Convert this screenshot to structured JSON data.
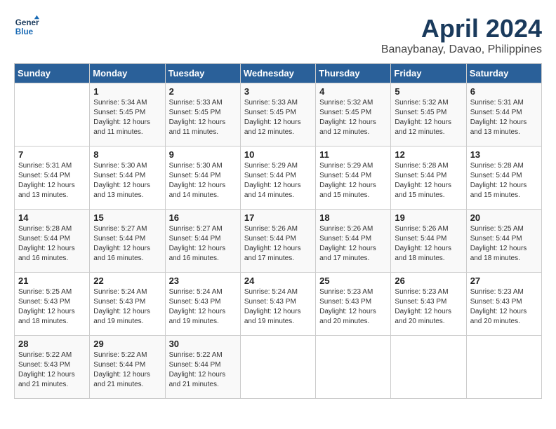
{
  "header": {
    "logo_line1": "General",
    "logo_line2": "Blue",
    "month_title": "April 2024",
    "subtitle": "Banaybanay, Davao, Philippines"
  },
  "weekdays": [
    "Sunday",
    "Monday",
    "Tuesday",
    "Wednesday",
    "Thursday",
    "Friday",
    "Saturday"
  ],
  "weeks": [
    [
      {
        "day": "",
        "info": ""
      },
      {
        "day": "1",
        "info": "Sunrise: 5:34 AM\nSunset: 5:45 PM\nDaylight: 12 hours\nand 11 minutes."
      },
      {
        "day": "2",
        "info": "Sunrise: 5:33 AM\nSunset: 5:45 PM\nDaylight: 12 hours\nand 11 minutes."
      },
      {
        "day": "3",
        "info": "Sunrise: 5:33 AM\nSunset: 5:45 PM\nDaylight: 12 hours\nand 12 minutes."
      },
      {
        "day": "4",
        "info": "Sunrise: 5:32 AM\nSunset: 5:45 PM\nDaylight: 12 hours\nand 12 minutes."
      },
      {
        "day": "5",
        "info": "Sunrise: 5:32 AM\nSunset: 5:45 PM\nDaylight: 12 hours\nand 12 minutes."
      },
      {
        "day": "6",
        "info": "Sunrise: 5:31 AM\nSunset: 5:44 PM\nDaylight: 12 hours\nand 13 minutes."
      }
    ],
    [
      {
        "day": "7",
        "info": "Sunrise: 5:31 AM\nSunset: 5:44 PM\nDaylight: 12 hours\nand 13 minutes."
      },
      {
        "day": "8",
        "info": "Sunrise: 5:30 AM\nSunset: 5:44 PM\nDaylight: 12 hours\nand 13 minutes."
      },
      {
        "day": "9",
        "info": "Sunrise: 5:30 AM\nSunset: 5:44 PM\nDaylight: 12 hours\nand 14 minutes."
      },
      {
        "day": "10",
        "info": "Sunrise: 5:29 AM\nSunset: 5:44 PM\nDaylight: 12 hours\nand 14 minutes."
      },
      {
        "day": "11",
        "info": "Sunrise: 5:29 AM\nSunset: 5:44 PM\nDaylight: 12 hours\nand 15 minutes."
      },
      {
        "day": "12",
        "info": "Sunrise: 5:28 AM\nSunset: 5:44 PM\nDaylight: 12 hours\nand 15 minutes."
      },
      {
        "day": "13",
        "info": "Sunrise: 5:28 AM\nSunset: 5:44 PM\nDaylight: 12 hours\nand 15 minutes."
      }
    ],
    [
      {
        "day": "14",
        "info": "Sunrise: 5:28 AM\nSunset: 5:44 PM\nDaylight: 12 hours\nand 16 minutes."
      },
      {
        "day": "15",
        "info": "Sunrise: 5:27 AM\nSunset: 5:44 PM\nDaylight: 12 hours\nand 16 minutes."
      },
      {
        "day": "16",
        "info": "Sunrise: 5:27 AM\nSunset: 5:44 PM\nDaylight: 12 hours\nand 16 minutes."
      },
      {
        "day": "17",
        "info": "Sunrise: 5:26 AM\nSunset: 5:44 PM\nDaylight: 12 hours\nand 17 minutes."
      },
      {
        "day": "18",
        "info": "Sunrise: 5:26 AM\nSunset: 5:44 PM\nDaylight: 12 hours\nand 17 minutes."
      },
      {
        "day": "19",
        "info": "Sunrise: 5:26 AM\nSunset: 5:44 PM\nDaylight: 12 hours\nand 18 minutes."
      },
      {
        "day": "20",
        "info": "Sunrise: 5:25 AM\nSunset: 5:44 PM\nDaylight: 12 hours\nand 18 minutes."
      }
    ],
    [
      {
        "day": "21",
        "info": "Sunrise: 5:25 AM\nSunset: 5:43 PM\nDaylight: 12 hours\nand 18 minutes."
      },
      {
        "day": "22",
        "info": "Sunrise: 5:24 AM\nSunset: 5:43 PM\nDaylight: 12 hours\nand 19 minutes."
      },
      {
        "day": "23",
        "info": "Sunrise: 5:24 AM\nSunset: 5:43 PM\nDaylight: 12 hours\nand 19 minutes."
      },
      {
        "day": "24",
        "info": "Sunrise: 5:24 AM\nSunset: 5:43 PM\nDaylight: 12 hours\nand 19 minutes."
      },
      {
        "day": "25",
        "info": "Sunrise: 5:23 AM\nSunset: 5:43 PM\nDaylight: 12 hours\nand 20 minutes."
      },
      {
        "day": "26",
        "info": "Sunrise: 5:23 AM\nSunset: 5:43 PM\nDaylight: 12 hours\nand 20 minutes."
      },
      {
        "day": "27",
        "info": "Sunrise: 5:23 AM\nSunset: 5:43 PM\nDaylight: 12 hours\nand 20 minutes."
      }
    ],
    [
      {
        "day": "28",
        "info": "Sunrise: 5:22 AM\nSunset: 5:43 PM\nDaylight: 12 hours\nand 21 minutes."
      },
      {
        "day": "29",
        "info": "Sunrise: 5:22 AM\nSunset: 5:44 PM\nDaylight: 12 hours\nand 21 minutes."
      },
      {
        "day": "30",
        "info": "Sunrise: 5:22 AM\nSunset: 5:44 PM\nDaylight: 12 hours\nand 21 minutes."
      },
      {
        "day": "",
        "info": ""
      },
      {
        "day": "",
        "info": ""
      },
      {
        "day": "",
        "info": ""
      },
      {
        "day": "",
        "info": ""
      }
    ]
  ]
}
